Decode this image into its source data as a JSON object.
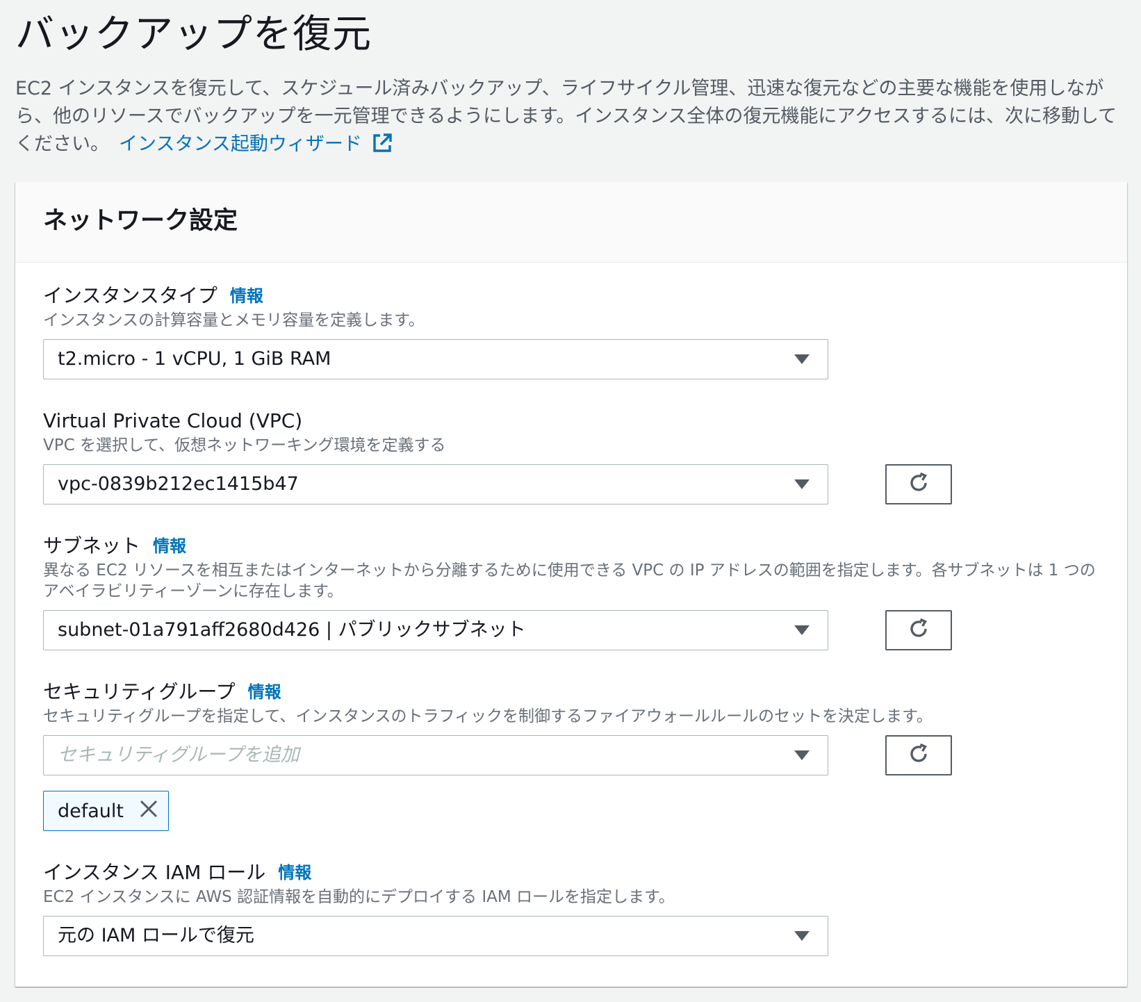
{
  "page": {
    "title": "バックアップを復元",
    "description": "EC2 インスタンスを復元して、スケジュール済みバックアップ、ライフサイクル管理、迅速な復元などの主要な機能を使用しながら、他のリソースでバックアップを一元管理できるようにします。インスタンス全体の復元機能にアクセスするには、次に移動してください。",
    "wizard_link": "インスタンス起動ウィザード",
    "wizard_link_icon": "external-link-icon"
  },
  "network_settings": {
    "title": "ネットワーク設定",
    "instance_type": {
      "label": "インスタンスタイプ",
      "info": "情報",
      "description": "インスタンスの計算容量とメモリ容量を定義します。",
      "value": "t2.micro - 1 vCPU, 1 GiB RAM"
    },
    "vpc": {
      "label": "Virtual Private Cloud (VPC)",
      "description": "VPC を選択して、仮想ネットワーキング環境を定義する",
      "value": "vpc-0839b212ec1415b47"
    },
    "subnet": {
      "label": "サブネット",
      "info": "情報",
      "description": "異なる EC2 リソースを相互またはインターネットから分離するために使用できる VPC の IP アドレスの範囲を指定します。各サブネットは 1 つのアベイラビリティーゾーンに存在します。",
      "value": "subnet-01a791aff2680d426 | パブリックサブネット"
    },
    "security_group": {
      "label": "セキュリティグループ",
      "info": "情報",
      "description": "セキュリティグループを指定して、インスタンスのトラフィックを制御するファイアウォールルールのセットを決定します。",
      "placeholder": "セキュリティグループを追加",
      "tokens": [
        "default"
      ]
    },
    "iam_role": {
      "label": "インスタンス IAM ロール",
      "info": "情報",
      "description": "EC2 インスタンスに AWS 認証情報を自動的にデプロイする IAM ロールを指定します。",
      "value": "元の IAM ロールで復元"
    }
  },
  "colors": {
    "link": "#0073bb",
    "border": "#aab7b8",
    "background": "#f2f3f3",
    "token_background": "#f1faff"
  }
}
